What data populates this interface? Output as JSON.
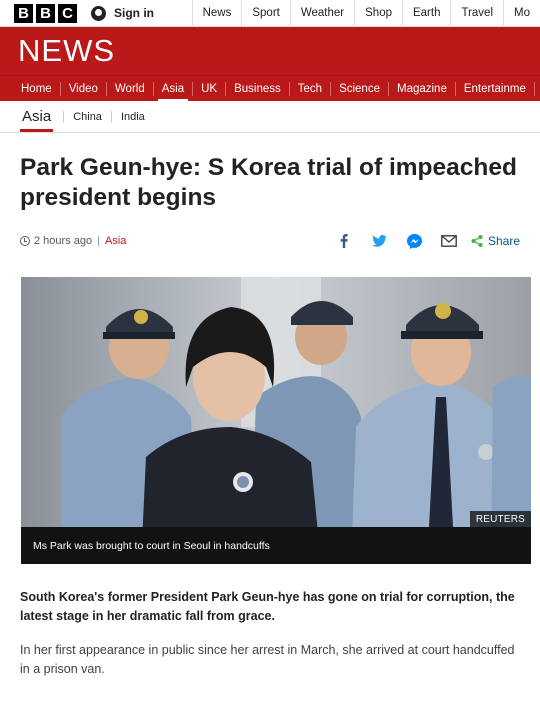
{
  "masthead": {
    "logo_letters": [
      "B",
      "B",
      "C"
    ],
    "signin_label": "Sign in",
    "nav": [
      "News",
      "Sport",
      "Weather",
      "Shop",
      "Earth",
      "Travel",
      "Mo"
    ]
  },
  "brand": {
    "wordmark": "NEWS",
    "color": "#bb1919"
  },
  "section_nav": [
    "Home",
    "Video",
    "World",
    "Asia",
    "UK",
    "Business",
    "Tech",
    "Science",
    "Magazine",
    "Entertainme"
  ],
  "section_nav_active": "Asia",
  "sub_nav": {
    "current": "Asia",
    "items": [
      "China",
      "India"
    ]
  },
  "article": {
    "headline": "Park Geun-hye: S Korea trial of impeached president begins",
    "timestamp": "2 hours ago",
    "section": "Asia",
    "share_label": "Share",
    "share_icons": [
      "facebook-icon",
      "twitter-icon",
      "messenger-icon",
      "email-icon",
      "share-icon"
    ],
    "image_credit": "REUTERS",
    "image_caption": "Ms Park was brought to court in Seoul in handcuffs",
    "lead": "South Korea's former President Park Geun-hye has gone on trial for corruption, the latest stage in her dramatic fall from grace.",
    "body": "In her first appearance in public since her arrest in March, she arrived at court handcuffed in a prison van."
  }
}
